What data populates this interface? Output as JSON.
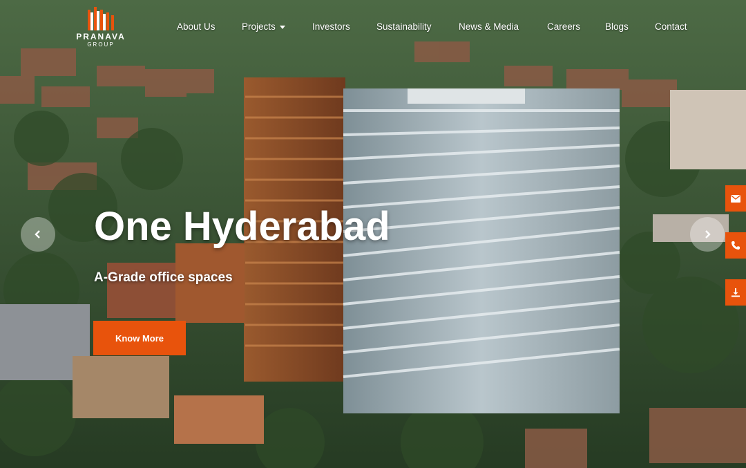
{
  "brand": {
    "name": "PRANAVA",
    "sub": "GROUP",
    "accent": "#e8530c"
  },
  "nav": {
    "items": [
      {
        "label": "About Us"
      },
      {
        "label": "Projects",
        "has_dropdown": true
      },
      {
        "label": "Investors"
      },
      {
        "label": "Sustainability"
      },
      {
        "label": "News & Media"
      },
      {
        "label": "Careers"
      },
      {
        "label": "Blogs"
      },
      {
        "label": "Contact"
      }
    ]
  },
  "slide": {
    "title": "One Hyderabad",
    "subtitle": "A-Grade office spaces",
    "cta_label": "Know More"
  },
  "carousel": {
    "prev_icon": "chevron-left-icon",
    "next_icon": "chevron-right-icon"
  },
  "side_actions": [
    {
      "icon": "mail-icon"
    },
    {
      "icon": "phone-icon"
    },
    {
      "icon": "download-icon"
    }
  ]
}
